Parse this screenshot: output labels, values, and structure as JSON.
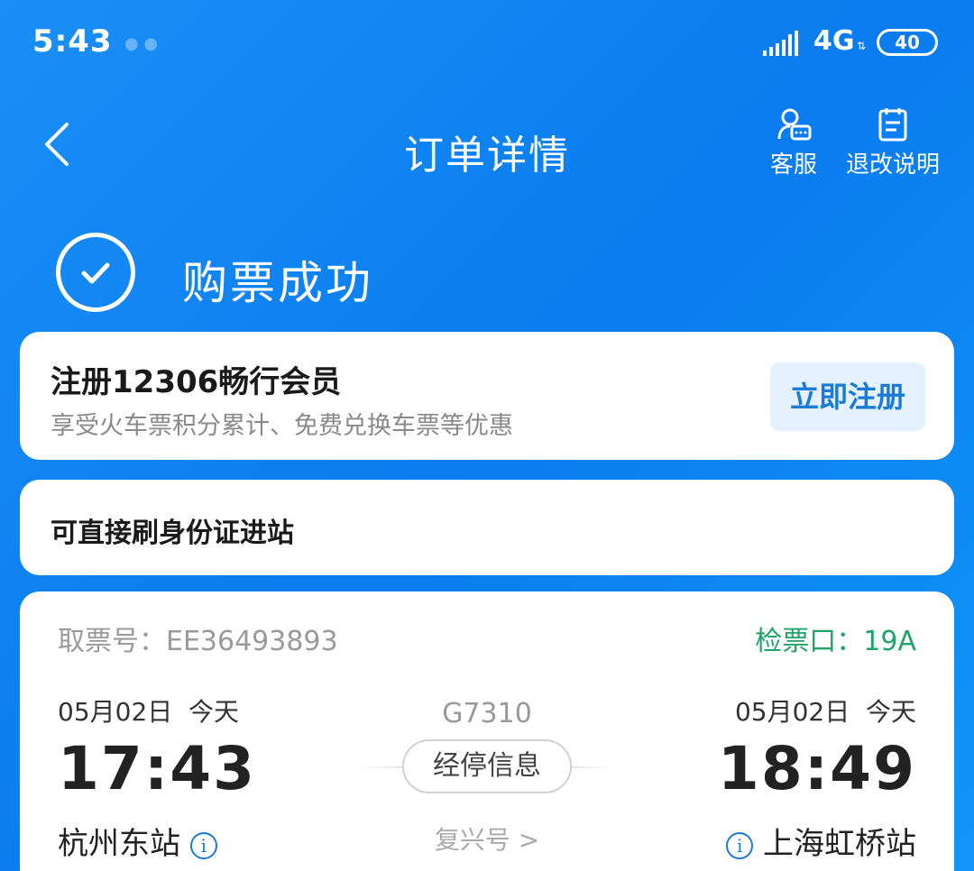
{
  "status": {
    "time": "5:43",
    "network": "4G",
    "battery": "40"
  },
  "nav": {
    "title": "订单详情",
    "service_label": "客服",
    "refund_label": "退改说明"
  },
  "success": {
    "text": "购票成功"
  },
  "member": {
    "title": "注册12306畅行会员",
    "subtitle": "享受火车票积分累计、免费兑换车票等优惠",
    "register_label": "立即注册"
  },
  "idcard": {
    "text": "可直接刷身份证进站"
  },
  "ticket": {
    "ticket_no": "取票号：EE36493893",
    "gate": "检票口：19A",
    "departure": {
      "date": "05月02日  今天",
      "time": "17:43",
      "station": "杭州东站"
    },
    "arrival": {
      "date": "05月02日  今天",
      "time": "18:49",
      "station": "上海虹桥站"
    },
    "train_no": "G7310",
    "stops_label": "经停信息",
    "train_type": "复兴号 >"
  },
  "colors": {
    "accent": "#1a7bd6",
    "gate": "#1fa36a",
    "background": "#0a7cf0"
  }
}
